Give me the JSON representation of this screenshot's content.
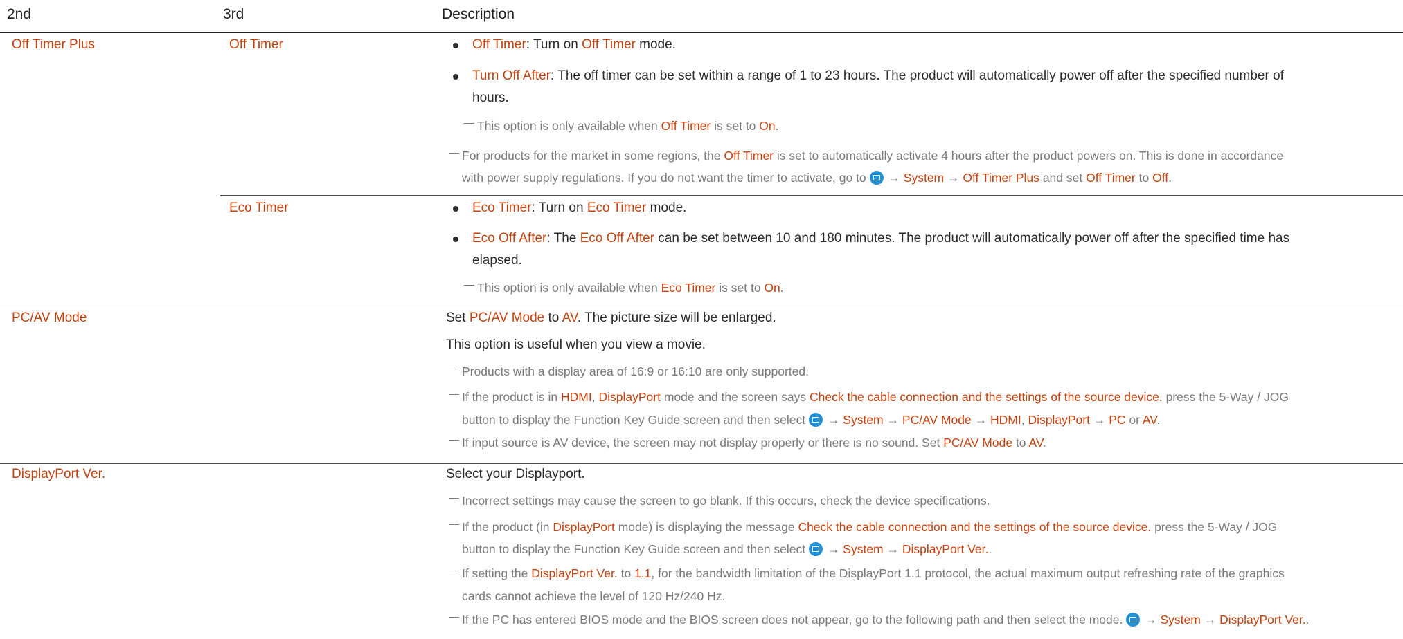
{
  "columns": {
    "c1": "2nd",
    "c2": "3rd",
    "c3": "Description"
  },
  "words": {
    "and_set": "and set",
    "to": "to",
    "or": "or",
    "comma": ",",
    "dot": ".",
    "arrow": "→"
  },
  "off_timer_plus": {
    "label": "Off Timer Plus",
    "off_timer": {
      "label": "Off Timer",
      "b1": {
        "hl": "Off Timer",
        "t1": ": Turn on",
        "hl2": "Off Timer",
        "t2": "mode."
      },
      "b2": {
        "hl": "Turn Off After",
        "t1": ": The off timer can be set within a range of 1 to 23 hours. The product will automatically power off after the specified number of",
        "t2": "hours."
      },
      "n1": {
        "t1": "This option is only available when",
        "hl": "Off Timer",
        "t2": "is set to",
        "hl2": "On"
      },
      "n2": {
        "t1": "For products for the market in some regions, the",
        "hl": "Off Timer",
        "t2": "is set to automatically activate 4 hours after the product powers on. This is done in accordance",
        "t3": "with power supply regulations. If you do not want the timer to activate, go to",
        "p1": "System",
        "p2": "Off Timer Plus",
        "hl3": "Off Timer",
        "hl4": "Off"
      }
    },
    "eco_timer": {
      "label": "Eco Timer",
      "b1": {
        "hl": "Eco Timer",
        "t1": ": Turn on",
        "hl2": "Eco Timer",
        "t2": "mode."
      },
      "b2": {
        "hl": "Eco Off After",
        "t1": ": The",
        "hl2": "Eco Off After",
        "t2": "can be set between 10 and 180 minutes. The product will automatically power off after the specified time has",
        "t3": "elapsed."
      },
      "n1": {
        "t1": "This option is only available when",
        "hl": "Eco Timer",
        "t2": "is set to",
        "hl2": "On"
      }
    }
  },
  "pc_av_mode": {
    "label": "PC/AV Mode",
    "l1": {
      "t1": "Set",
      "hl": "PC/AV Mode",
      "t2": "to",
      "hl2": "AV",
      "t3": ". The picture size will be enlarged."
    },
    "l2": "This option is useful when you view a movie.",
    "n1": "Products with a display area of 16:9 or 16:10 are only supported.",
    "n2": {
      "t1": "If the product is in",
      "hl": "HDMI",
      "hl2": "DisplayPort",
      "t2": "mode and the screen says",
      "hl3": "Check the cable connection and the settings of the source device.",
      "t3": "press the 5-Way / JOG",
      "t4": "button to display the Function Key Guide screen and then select",
      "p1": "System",
      "p2": "PC/AV Mode",
      "p3": "HDMI",
      "p4": "DisplayPort",
      "p5": "PC",
      "p6": "AV"
    },
    "n3": {
      "t1": "If input source is AV device, the screen may not display properly or there is no sound. Set",
      "hl": "PC/AV Mode",
      "t2": "to",
      "hl2": "AV"
    }
  },
  "displayport_ver": {
    "label": "DisplayPort Ver.",
    "l1": "Select your Displayport.",
    "n1": "Incorrect settings may cause the screen to go blank. If this occurs, check the device specifications.",
    "n2": {
      "t1": "If the product (in",
      "hl": "DisplayPort",
      "t2": "mode) is displaying the message",
      "hl2": "Check the cable connection and the settings of the source device.",
      "t3": "press the 5-Way / JOG",
      "t4": "button to display the Function Key Guide screen and then select",
      "p1": "System",
      "p2": "DisplayPort Ver."
    },
    "n3": {
      "t1": "If setting the",
      "hl": "DisplayPort Ver.",
      "t2": "to",
      "hl2": "1.1",
      "t3": ", for the bandwidth limitation of the DisplayPort 1.1 protocol, the actual maximum output refreshing rate of the graphics",
      "t4": "cards cannot achieve the level of 120 Hz/240 Hz."
    },
    "n4": {
      "t1": "If the PC has entered BIOS mode and the BIOS screen does not appear, go to the following path and then select the mode.",
      "p1": "System",
      "p2": "DisplayPort Ver."
    }
  }
}
